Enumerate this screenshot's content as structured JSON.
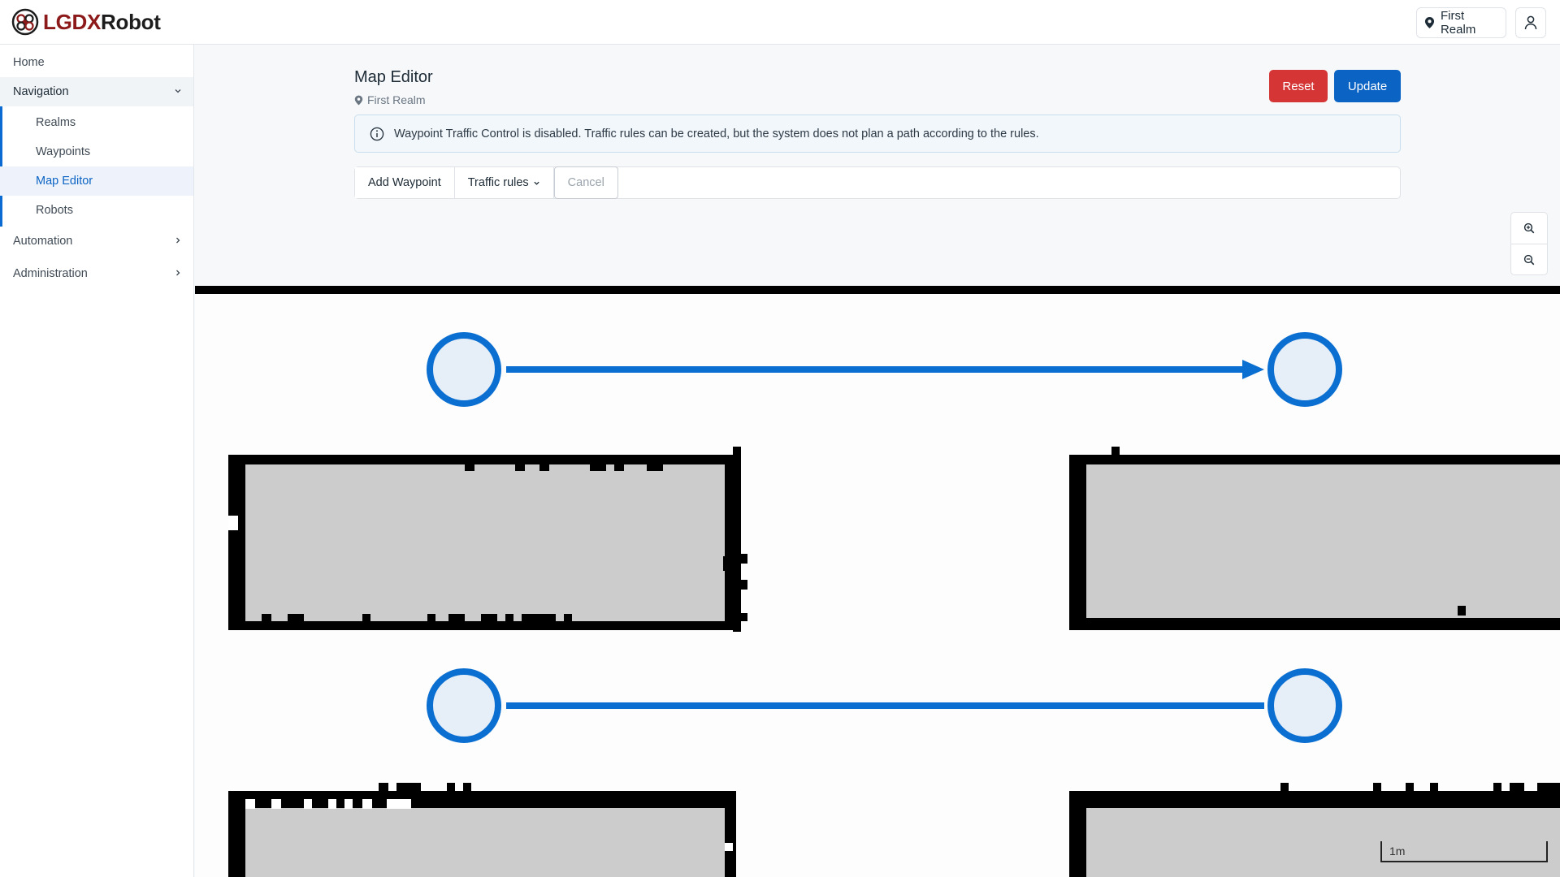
{
  "brand": {
    "name_part1": "LGDX",
    "name_part2": "Robot"
  },
  "header": {
    "realm_label": "First Realm"
  },
  "sidebar": {
    "home": "Home",
    "navigation": "Navigation",
    "navigation_items": [
      "Realms",
      "Waypoints",
      "Map Editor",
      "Robots"
    ],
    "active_item": "Map Editor",
    "automation": "Automation",
    "administration": "Administration"
  },
  "page": {
    "title": "Map Editor",
    "realm": "First Realm",
    "reset_label": "Reset",
    "update_label": "Update"
  },
  "alert": {
    "message": "Waypoint Traffic Control is disabled. Traffic rules can be created, but the system does not plan a path according to the rules."
  },
  "toolbar": {
    "add_waypoint": "Add Waypoint",
    "traffic_rules": "Traffic rules",
    "cancel": "Cancel"
  },
  "map": {
    "scale_label": "1m",
    "waypoint_stroke": "#0b6fd1",
    "waypoint_fill": "#e6eef8",
    "obstacle_fill": "#cccccc"
  },
  "colors": {
    "accent": "#0b63c4",
    "danger": "#d63535",
    "brand_red": "#8c1a1a"
  }
}
